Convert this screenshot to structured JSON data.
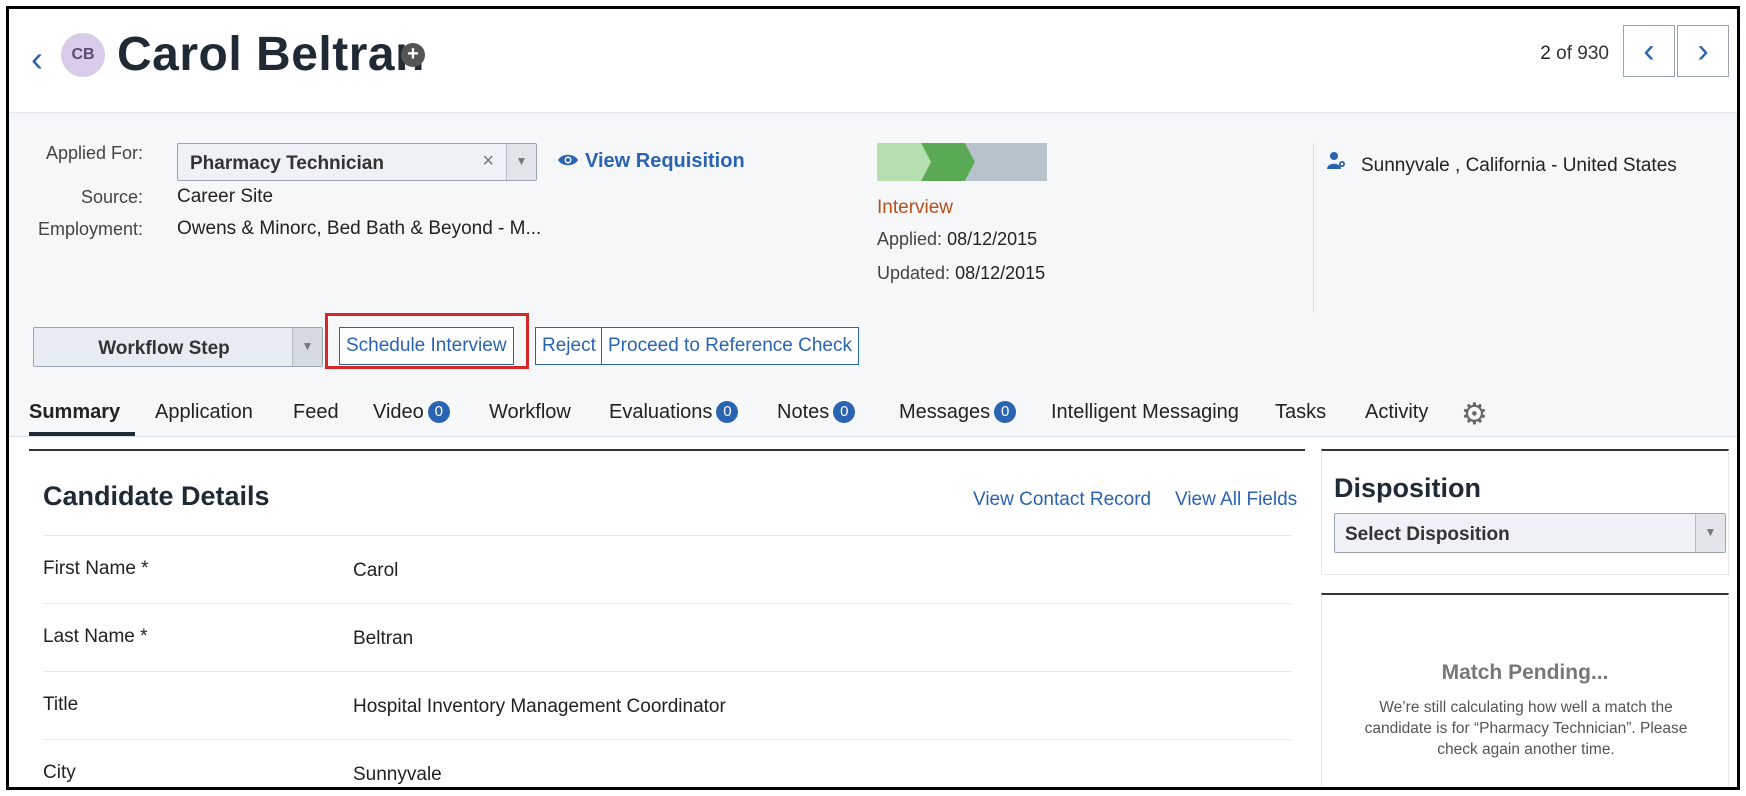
{
  "header": {
    "initials": "CB",
    "candidate_name": "Carol Beltran",
    "pager_current": "2",
    "pager_of": "of",
    "pager_total": "930"
  },
  "info": {
    "applied_for_label": "Applied For:",
    "applied_for_value": "Pharmacy Technician",
    "view_requisition": "View Requisition",
    "source_label": "Source:",
    "source_value": "Career Site",
    "employment_label": "Employment:",
    "employment_value": "Owens & Minorc, Bed Bath & Beyond - M...",
    "status": "Interview",
    "applied_label": "Applied:",
    "applied_date": "08/12/2015",
    "updated_label": "Updated:",
    "updated_date": "08/12/2015",
    "location": "Sunnyvale , California - United States",
    "stage_colors": [
      "#b6dfb0",
      "#5aaa55",
      "#b7c2cc",
      "#b7c2cc"
    ]
  },
  "actions": {
    "workflow_step": "Workflow Step",
    "schedule_interview": "Schedule Interview",
    "reject": "Reject",
    "proceed": "Proceed to Reference Check"
  },
  "tabs": {
    "summary": "Summary",
    "application": "Application",
    "feed": "Feed",
    "video": "Video",
    "video_count": "0",
    "workflow": "Workflow",
    "evaluations": "Evaluations",
    "evaluations_count": "0",
    "notes": "Notes",
    "notes_count": "0",
    "messages": "Messages",
    "messages_count": "0",
    "intelligent_messaging": "Intelligent Messaging",
    "tasks": "Tasks",
    "activity": "Activity"
  },
  "details": {
    "title": "Candidate Details",
    "view_contact": "View Contact Record",
    "view_all": "View All Fields",
    "rows": [
      {
        "label": "First Name *",
        "value": "Carol"
      },
      {
        "label": "Last Name *",
        "value": "Beltran"
      },
      {
        "label": "Title",
        "value": "Hospital Inventory Management Coordinator"
      },
      {
        "label": "City",
        "value": "Sunnyvale"
      }
    ]
  },
  "disposition": {
    "title": "Disposition",
    "select_placeholder": "Select Disposition"
  },
  "match": {
    "title": "Match Pending...",
    "text": "We’re still calculating how well a match the candidate is for “Pharmacy Technician”. Please check again another time."
  },
  "colors": {
    "accent": "#2a63b1",
    "status": "#b8501a",
    "highlight": "#d62828"
  }
}
